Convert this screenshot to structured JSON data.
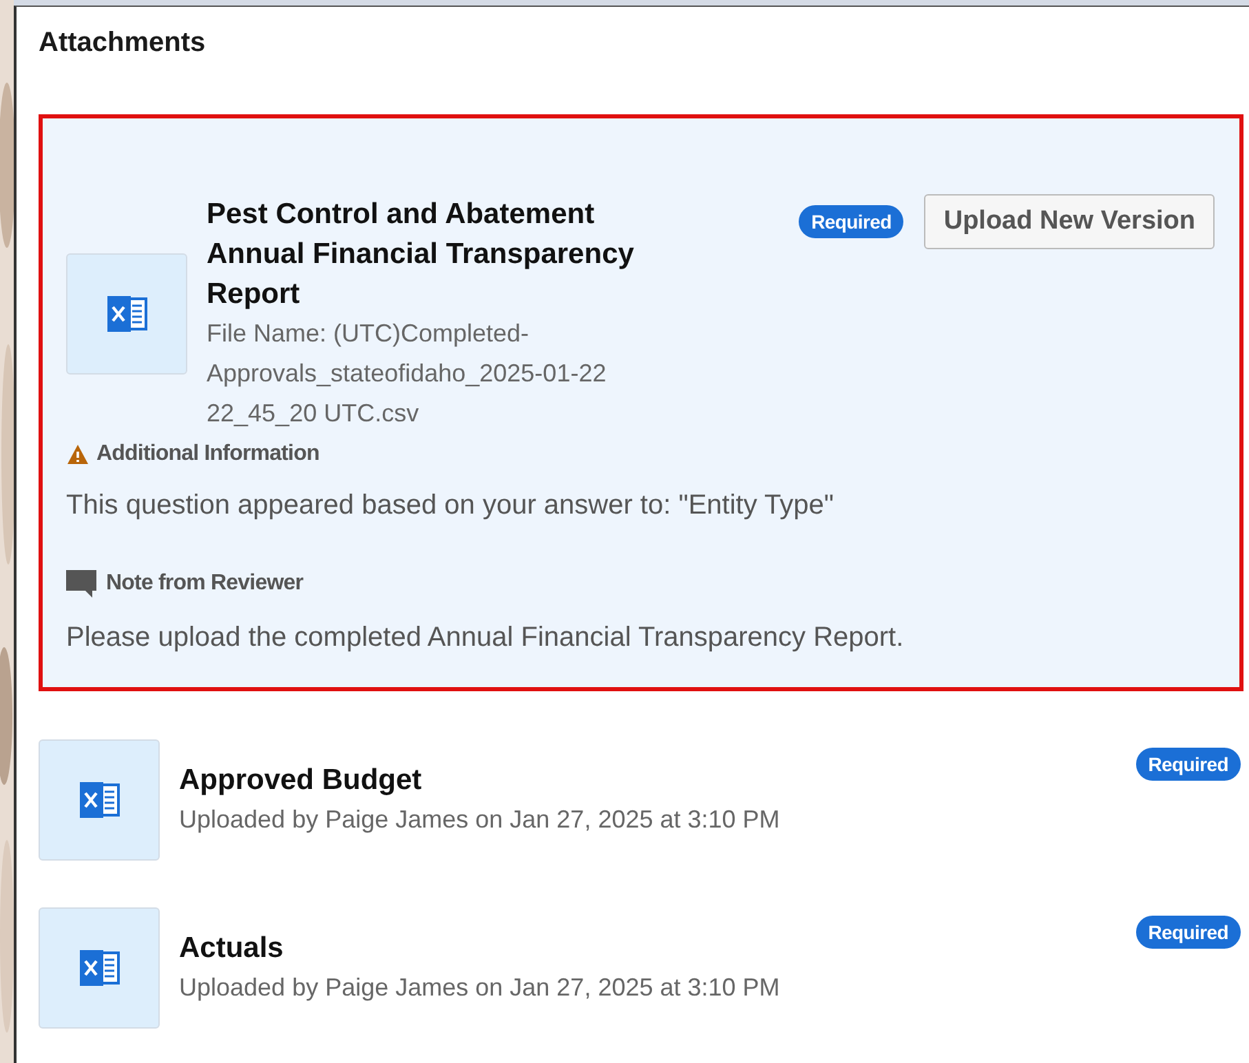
{
  "section": {
    "title": "Attachments"
  },
  "attachments": [
    {
      "title": "Pest Control and Abatement Annual Financial Transparency Report",
      "highlighted": true,
      "subtitle": "File Name: (UTC)Completed-Approvals_stateofidaho_2025-01-22 22_45_20 UTC.csv",
      "badge": "Required",
      "button": "Upload New Version",
      "additional_info": {
        "heading": "Additional Information",
        "text": "This question appeared based on your answer to: \"Entity Type\""
      },
      "reviewer_note": {
        "heading": "Note from Reviewer",
        "text": "Please upload the completed Annual Financial Transparency Report."
      }
    },
    {
      "title": "Approved Budget",
      "highlighted": false,
      "subtitle": "Uploaded by Paige James on Jan 27, 2025 at 3:10 PM",
      "badge": "Required"
    },
    {
      "title": "Actuals",
      "highlighted": false,
      "subtitle": "Uploaded by Paige James on Jan 27, 2025 at 3:10 PM",
      "badge": "Required"
    }
  ]
}
